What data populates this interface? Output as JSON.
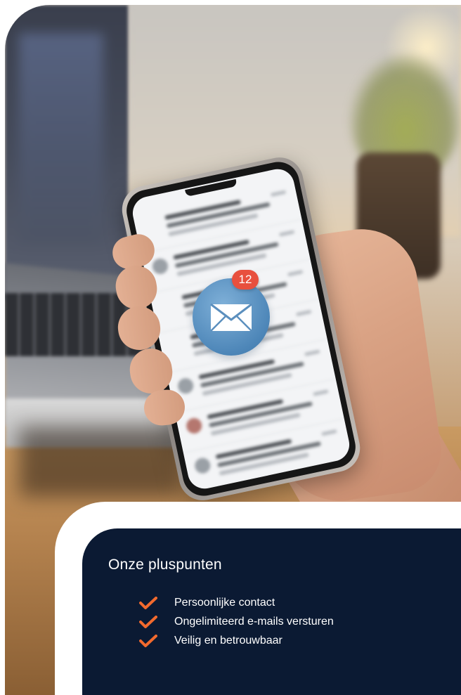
{
  "notification": {
    "count": "12"
  },
  "card": {
    "title": "Onze pluspunten",
    "benefits": [
      {
        "label": "Persoonlijke contact"
      },
      {
        "label": "Ongelimiteerd e-mails versturen"
      },
      {
        "label": "Veilig en betrouwbaar"
      }
    ]
  },
  "icons": {
    "envelope": "envelope-icon",
    "check": "checkmark-icon",
    "badge": "notification-badge"
  },
  "colors": {
    "card_background": "#0b1a33",
    "check_accent": "#f26a2e",
    "badge_red": "#e8503e",
    "envelope_blue": "#4d86b8"
  }
}
